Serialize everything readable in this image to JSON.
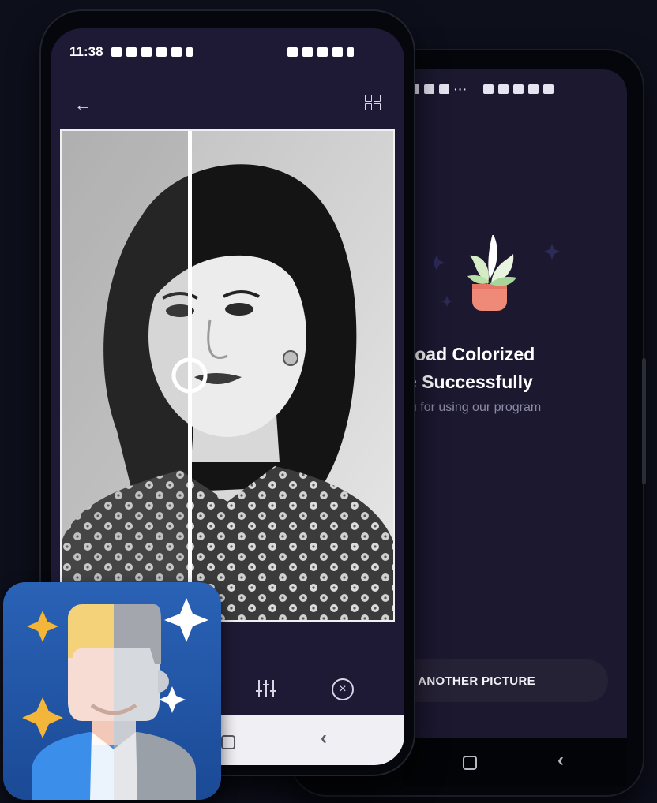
{
  "front_phone": {
    "status_time": "11:38",
    "toolbar_icons": [
      "sliders-icon",
      "close-circle-icon"
    ],
    "header_icons": [
      "back-arrow-icon",
      "grid-icon"
    ]
  },
  "back_phone": {
    "title_line1": "ynload Colorized",
    "title_line2": "ure Successfully",
    "subtitle": "ou for using our program",
    "button_label": ") ANOTHER PICTURE"
  },
  "colors": {
    "background": "#0d0f1b",
    "screen": "#1e1a35",
    "plant_pot": "#f08a78",
    "leaf": "#d6ecc6",
    "icon_blue": "#2a62b6",
    "star_gold": "#f3b63a"
  }
}
